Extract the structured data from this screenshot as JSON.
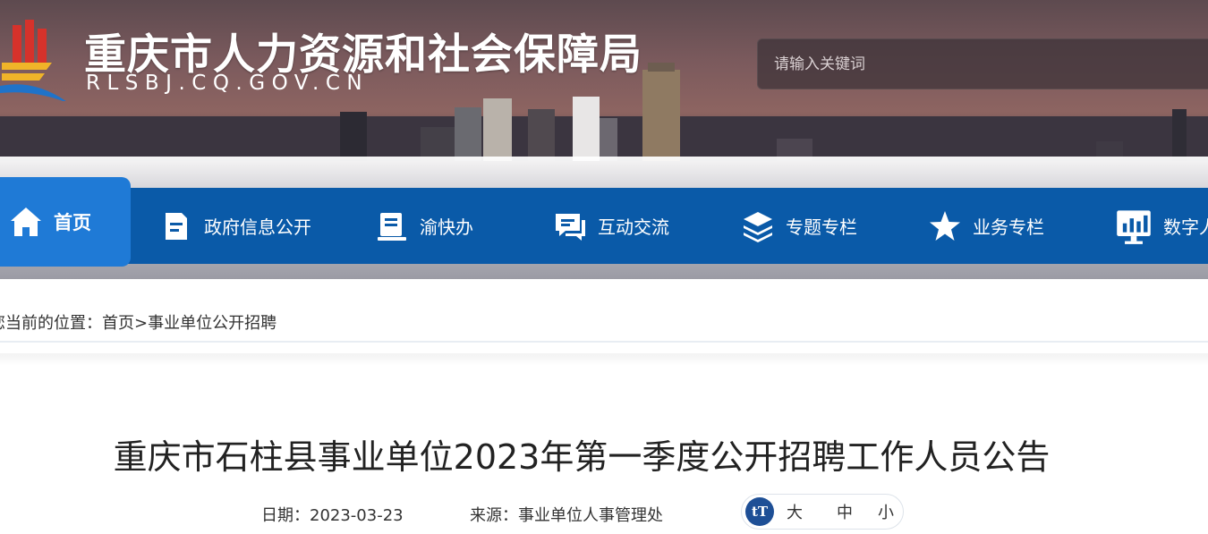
{
  "header": {
    "title": "重庆市人力资源和社会保障局",
    "domain": "RLSBJ.CQ.GOV.CN",
    "search_placeholder": "请输入关键词"
  },
  "nav": {
    "items": [
      {
        "label": "首页",
        "icon": "home-icon",
        "active": true
      },
      {
        "label": "政府信息公开",
        "icon": "document-icon"
      },
      {
        "label": "渝快办",
        "icon": "book-icon"
      },
      {
        "label": "互动交流",
        "icon": "chat-icon"
      },
      {
        "label": "专题专栏",
        "icon": "layers-icon"
      },
      {
        "label": "业务专栏",
        "icon": "star-icon"
      },
      {
        "label": "数字人",
        "icon": "monitor-chart-icon"
      }
    ]
  },
  "breadcrumb": {
    "prefix": "您当前的位置：",
    "home": "首页",
    "separator": ">",
    "current": "事业单位公开招聘"
  },
  "article": {
    "title": "重庆市石柱县事业单位2023年第一季度公开招聘工作人员公告",
    "date_label": "日期：",
    "date": "2023-03-23",
    "source_label": "来源：",
    "source": "事业单位人事管理处"
  },
  "font_size": {
    "icon": "text-size-icon",
    "icon_text": "tT",
    "options": [
      "大",
      "中",
      "小"
    ]
  },
  "colors": {
    "nav_bg": "#0a5aa8",
    "nav_active": "#1f7ad6",
    "font_icon_bg": "#1e4f96"
  }
}
